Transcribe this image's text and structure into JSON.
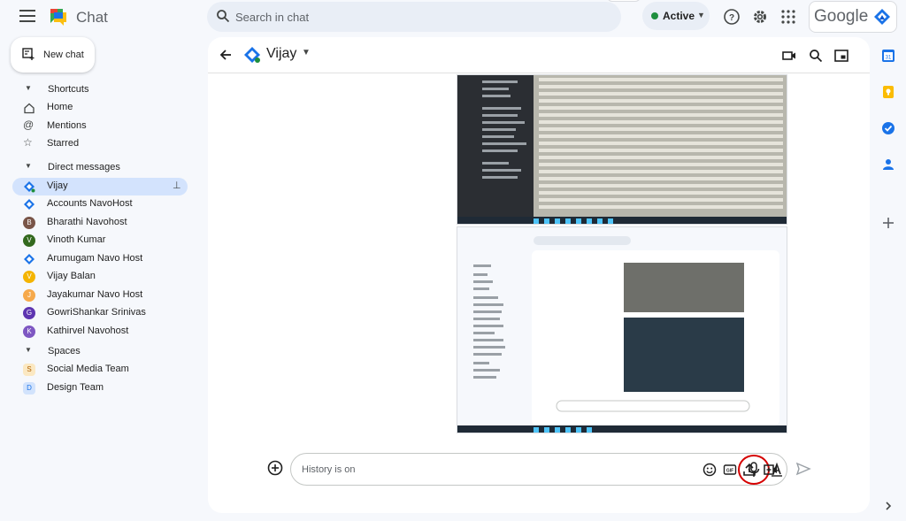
{
  "app": {
    "title": "Chat"
  },
  "search": {
    "placeholder": "Search in chat"
  },
  "status": {
    "label": "Active",
    "color": "#1e8e3e"
  },
  "header_icons": [
    "help-icon",
    "settings-icon",
    "apps-grid-icon"
  ],
  "account": {
    "brand": "Google"
  },
  "sidebar": {
    "new_chat_label": "New chat",
    "shortcuts": {
      "heading": "Shortcuts",
      "items": [
        {
          "label": "Home",
          "icon": "home-icon"
        },
        {
          "label": "Mentions",
          "icon": "at-icon"
        },
        {
          "label": "Starred",
          "icon": "star-icon"
        }
      ]
    },
    "direct_messages": {
      "heading": "Direct messages",
      "items": [
        {
          "label": "Vijay",
          "avatar": "navo-logo",
          "active": true,
          "pinned": true
        },
        {
          "label": "Accounts NavoHost",
          "avatar": "navo-logo"
        },
        {
          "label": "Bharathi Navohost",
          "avatar": "photo",
          "color": "#795548"
        },
        {
          "label": "Vinoth Kumar",
          "avatar": "V",
          "color": "#33691e"
        },
        {
          "label": "Arumugam Navo Host",
          "avatar": "navo-logo"
        },
        {
          "label": "Vijay Balan",
          "avatar": "photo",
          "color": "#f4b400"
        },
        {
          "label": "Jayakumar Navo Host",
          "avatar": "J",
          "color": "#f6a94b"
        },
        {
          "label": "GowriShankar Srinivas",
          "avatar": "G",
          "color": "#5e35b1"
        },
        {
          "label": "Kathirvel Navohost",
          "avatar": "K",
          "color": "#7e57c2"
        }
      ]
    },
    "spaces": {
      "heading": "Spaces",
      "items": [
        {
          "label": "Social Media Team",
          "avatar": "S",
          "color": "#fbe8c2",
          "text_color": "#b06000"
        },
        {
          "label": "Design Team",
          "avatar": "D",
          "color": "#d2e3fc",
          "text_color": "#1a73e8"
        }
      ]
    }
  },
  "chat": {
    "name": "Vijay",
    "header_icons": [
      "video-call-icon",
      "search-icon",
      "picture-in-picture-icon"
    ],
    "messages": [
      {
        "type": "image",
        "description": "gmail-inbox-screenshot"
      },
      {
        "type": "image",
        "description": "google-chat-screenshot"
      }
    ]
  },
  "composer": {
    "placeholder": "History is on",
    "icons": [
      "microphone-icon",
      "text-format-icon",
      "emoji-icon",
      "gif-icon",
      "upload-icon",
      "add-video-icon"
    ],
    "highlight_color": "#d50000"
  },
  "rail": {
    "icons": [
      "calendar-icon",
      "keep-icon",
      "tasks-icon",
      "contacts-icon",
      "add-icon"
    ]
  }
}
